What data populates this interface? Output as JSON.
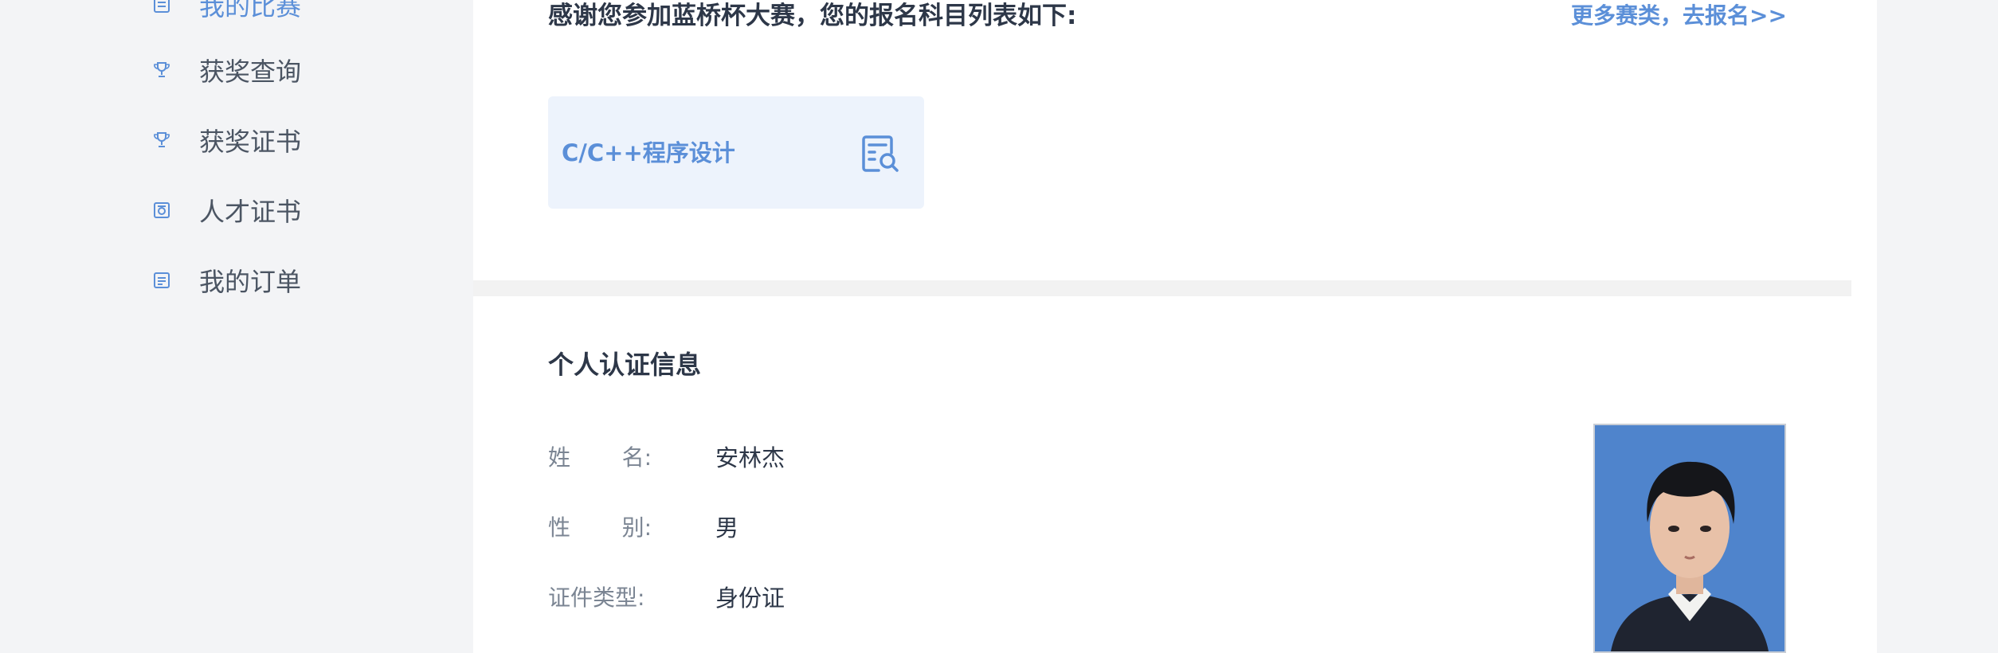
{
  "sidebar": {
    "items": [
      {
        "label": "我的比赛",
        "icon": "list-icon",
        "active": true
      },
      {
        "label": "获奖查询",
        "icon": "trophy-icon"
      },
      {
        "label": "获奖证书",
        "icon": "trophy-icon"
      },
      {
        "label": "人才证书",
        "icon": "certificate-icon"
      },
      {
        "label": "我的订单",
        "icon": "order-icon"
      }
    ]
  },
  "main": {
    "thanks_text": "感谢您参加蓝桥杯大赛，您的报名科目列表如下:",
    "more_link": "更多赛类，去报名>>",
    "subjects": [
      {
        "name": "C/C++程序设计",
        "icon": "search-document-icon"
      }
    ]
  },
  "profile": {
    "title": "个人认证信息",
    "fields": [
      {
        "label_chars": [
          "姓",
          "名:"
        ],
        "value": "安林杰"
      },
      {
        "label_chars": [
          "性",
          "别:"
        ],
        "value": "男"
      },
      {
        "label": "证件类型:",
        "value": "身份证"
      }
    ],
    "photo": "id-photo"
  },
  "colors": {
    "accent": "#5b8fd8",
    "card_bg": "#edf3fc",
    "page_bg": "#f3f4f6",
    "text_dark": "#2d3748",
    "text_muted": "#7b8593"
  }
}
